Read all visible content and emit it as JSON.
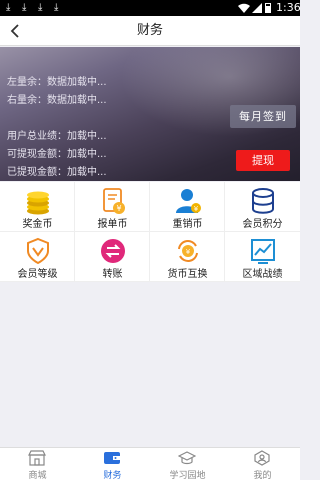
{
  "status_bar": {
    "time": "1:36",
    "download_icons": [
      "download-icon",
      "download-icon",
      "download-icon",
      "download-icon"
    ]
  },
  "header": {
    "title": "财务",
    "back_icon": "chevron-left-icon"
  },
  "banner": {
    "lines": [
      "左量余：数据加载中...",
      "右量余：数据加载中...",
      "用户总业绩：加载中...",
      "可提现金额：加载中...",
      "已提现金额：加载中..."
    ],
    "monthly_checkin_label": "每月签到",
    "withdraw_label": "提现"
  },
  "grid": [
    {
      "label": "奖金币",
      "icon": "coins-icon"
    },
    {
      "label": "报单币",
      "icon": "document-coin-icon"
    },
    {
      "label": "重销币",
      "icon": "user-coin-icon"
    },
    {
      "label": "会员积分",
      "icon": "database-icon"
    },
    {
      "label": "会员等级",
      "icon": "shield-v-icon"
    },
    {
      "label": "转账",
      "icon": "transfer-icon"
    },
    {
      "label": "货币互换",
      "icon": "exchange-icon"
    },
    {
      "label": "区域战绩",
      "icon": "chart-icon"
    }
  ],
  "tabs": [
    {
      "label": "商城",
      "icon": "store-icon",
      "active": false
    },
    {
      "label": "财务",
      "icon": "wallet-icon",
      "active": true
    },
    {
      "label": "学习园地",
      "icon": "graduation-cap-icon",
      "active": false
    },
    {
      "label": "我的",
      "icon": "profile-icon",
      "active": false
    }
  ],
  "colors": {
    "accent": "#2a6fdc",
    "withdraw": "#ee1b1b",
    "banner_dark": "#2e2838"
  }
}
